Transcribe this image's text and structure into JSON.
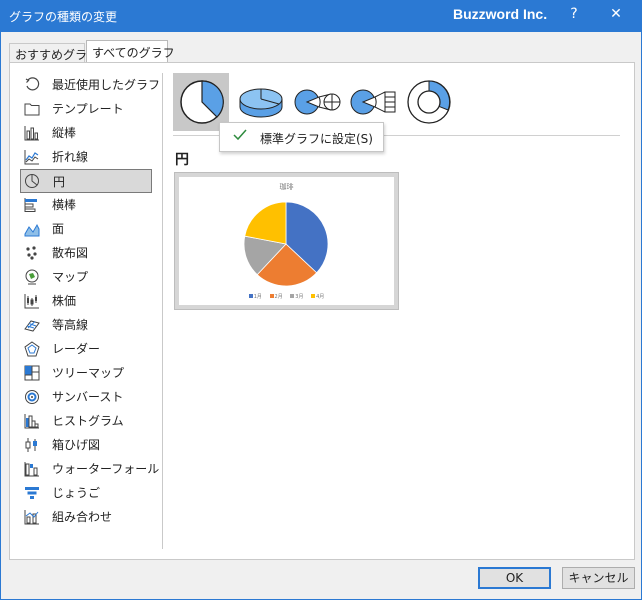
{
  "window": {
    "title": "グラフの種類の変更",
    "brand": "Buzzword Inc.",
    "help_glyph": "?",
    "close_glyph": "✕"
  },
  "tabs": [
    {
      "label": "おすすめグラフ",
      "selected": false
    },
    {
      "label": "すべてのグラフ",
      "selected": true
    }
  ],
  "sidebar": {
    "items": [
      {
        "label": "最近使用したグラフ",
        "icon": "recent-icon"
      },
      {
        "label": "テンプレート",
        "icon": "folder-icon"
      },
      {
        "label": "縦棒",
        "icon": "column-chart-icon"
      },
      {
        "label": "折れ線",
        "icon": "line-chart-icon"
      },
      {
        "label": "円",
        "icon": "pie-chart-icon",
        "selected": true
      },
      {
        "label": "横棒",
        "icon": "bar-chart-icon"
      },
      {
        "label": "面",
        "icon": "area-chart-icon"
      },
      {
        "label": "散布図",
        "icon": "scatter-chart-icon"
      },
      {
        "label": "マップ",
        "icon": "map-chart-icon"
      },
      {
        "label": "株価",
        "icon": "stock-chart-icon"
      },
      {
        "label": "等高線",
        "icon": "surface-chart-icon"
      },
      {
        "label": "レーダー",
        "icon": "radar-chart-icon"
      },
      {
        "label": "ツリーマップ",
        "icon": "treemap-chart-icon"
      },
      {
        "label": "サンバースト",
        "icon": "sunburst-chart-icon"
      },
      {
        "label": "ヒストグラム",
        "icon": "histogram-chart-icon"
      },
      {
        "label": "箱ひげ図",
        "icon": "boxwhisker-chart-icon"
      },
      {
        "label": "ウォーターフォール",
        "icon": "waterfall-chart-icon"
      },
      {
        "label": "じょうご",
        "icon": "funnel-chart-icon"
      },
      {
        "label": "組み合わせ",
        "icon": "combo-chart-icon"
      }
    ]
  },
  "subtypes": [
    {
      "icon": "pie-subtype-icon",
      "selected": true
    },
    {
      "icon": "pie-3d-subtype-icon",
      "selected": false
    },
    {
      "icon": "pie-of-pie-subtype-icon",
      "selected": false
    },
    {
      "icon": "bar-of-pie-subtype-icon",
      "selected": false
    },
    {
      "icon": "doughnut-subtype-icon",
      "selected": false
    }
  ],
  "context_menu": {
    "label": "標準グラフに設定(S)"
  },
  "chart_type_name": "円",
  "preview": {
    "title": "珈琲",
    "legend": [
      "1月",
      "2月",
      "3月",
      "4月"
    ]
  },
  "chart_data": {
    "type": "pie",
    "title": "珈琲",
    "categories": [
      "1月",
      "2月",
      "3月",
      "4月"
    ],
    "values": [
      37,
      25,
      16,
      22
    ],
    "colors": [
      "#4472c4",
      "#ed7d31",
      "#a5a5a5",
      "#ffc000"
    ],
    "legend_position": "bottom"
  },
  "buttons": {
    "ok": "OK",
    "cancel": "キャンセル"
  },
  "colors": {
    "titlebar": "#2b79d3",
    "accent": "#5aa0e6"
  }
}
